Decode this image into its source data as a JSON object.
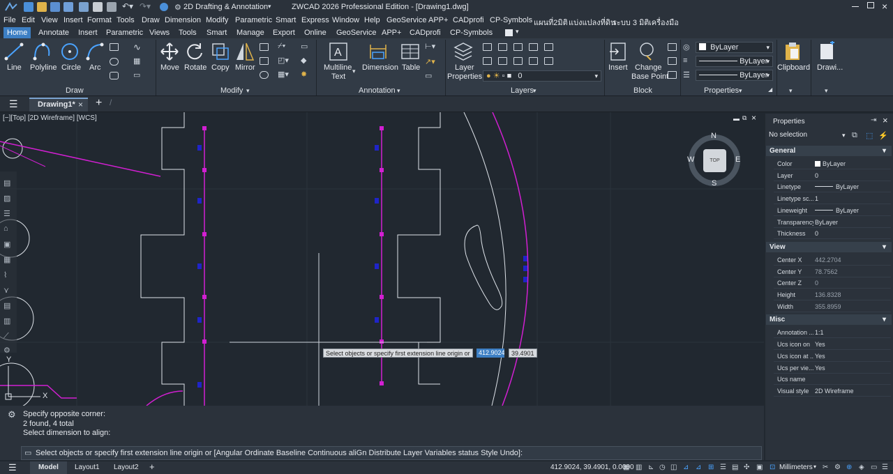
{
  "window": {
    "workspace": "2D Drafting & Annotation",
    "title": "ZWCAD 2026 Professional Edition - [Drawing1.dwg]"
  },
  "menu": [
    "File",
    "Edit",
    "View",
    "Insert",
    "Format",
    "Tools",
    "Draw",
    "Dimension",
    "Modify",
    "Parametric",
    "Smart",
    "Express",
    "Window",
    "Help",
    "GeoService",
    "APP+",
    "CADprofi",
    "CP-Symbols",
    "แผนที่2มิติ",
    "แบ่งแปลงที่ดิน",
    "ระบบ 3 มิติ",
    "เครื่องมือ"
  ],
  "ribbon_tabs": [
    "Home",
    "Annotate",
    "Insert",
    "Parametric",
    "Views",
    "Tools",
    "Smart",
    "Manage",
    "Export",
    "Online",
    "GeoService",
    "APP+",
    "CADprofi",
    "CP-Symbols"
  ],
  "ribbon": {
    "draw": {
      "line": "Line",
      "polyline": "Polyline",
      "circle": "Circle",
      "arc": "Arc",
      "title": "Draw"
    },
    "modify": {
      "move": "Move",
      "rotate": "Rotate",
      "copy": "Copy",
      "mirror": "Mirror",
      "title": "Modify"
    },
    "annotation": {
      "mtext_1": "Multiline",
      "mtext_2": "Text",
      "dimension": "Dimension",
      "table": "Table",
      "title": "Annotation"
    },
    "layers": {
      "props_1": "Layer",
      "props_2": "Properties",
      "current": "0",
      "title": "Layers"
    },
    "block": {
      "insert": "Insert",
      "cbp_1": "Change",
      "cbp_2": "Base Point",
      "title": "Block"
    },
    "properties": {
      "color": "ByLayer",
      "linetype": "ByLayer",
      "lineweight": "ByLayer",
      "title": "Properties"
    },
    "clipboard": "Clipboard",
    "drawing": "Drawi..."
  },
  "doc_tab": "Drawing1*",
  "view_label": "[−][Top] [2D Wireframe] [WCS]",
  "viewcube": {
    "n": "N",
    "s": "S",
    "e": "E",
    "w": "W",
    "face": "TOP"
  },
  "ucs": {
    "x": "X",
    "y": "Y"
  },
  "dyn_input": {
    "prompt": "Select objects or specify first extension line origin or",
    "x": "412.9024",
    "y": "39.4901"
  },
  "command_history": [
    "Specify opposite corner:",
    "2 found, 4 total",
    "Select dimension to align:"
  ],
  "command_prompt": "Select objects or specify first extension line origin or [Angular Ordinate Baseline Continuous aliGn Distribute Layer Variables status Style Undo]:",
  "layout_tabs": [
    "Model",
    "Layout1",
    "Layout2"
  ],
  "status": {
    "coords": "412.9024, 39.4901, 0.0000",
    "units": "Millimeters"
  },
  "properties": {
    "title": "Properties",
    "selection": "No selection",
    "sections": [
      {
        "name": "General",
        "rows": [
          [
            "Color",
            "ByLayer"
          ],
          [
            "Layer",
            "0"
          ],
          [
            "Linetype",
            "ByLayer"
          ],
          [
            "Linetype sc...",
            "1"
          ],
          [
            "Lineweight",
            "ByLayer"
          ],
          [
            "Transparency",
            "ByLayer"
          ],
          [
            "Thickness",
            "0"
          ]
        ]
      },
      {
        "name": "View",
        "rows": [
          [
            "Center X",
            "442.2704"
          ],
          [
            "Center Y",
            "78.7562"
          ],
          [
            "Center Z",
            "0"
          ],
          [
            "Height",
            "136.8328"
          ],
          [
            "Width",
            "355.8959"
          ]
        ]
      },
      {
        "name": "Misc",
        "rows": [
          [
            "Annotation ...",
            "1:1"
          ],
          [
            "Ucs icon on",
            "Yes"
          ],
          [
            "Ucs icon at ...",
            "Yes"
          ],
          [
            "Ucs per vie...",
            "Yes"
          ],
          [
            "Ucs name",
            ""
          ],
          [
            "Visual style",
            "2D Wireframe"
          ]
        ]
      }
    ]
  },
  "colors": {
    "accent": "#3d7fc4",
    "magenta": "#d21fd2",
    "blue_marker": "#1f24c8",
    "canvas": "#212830"
  }
}
